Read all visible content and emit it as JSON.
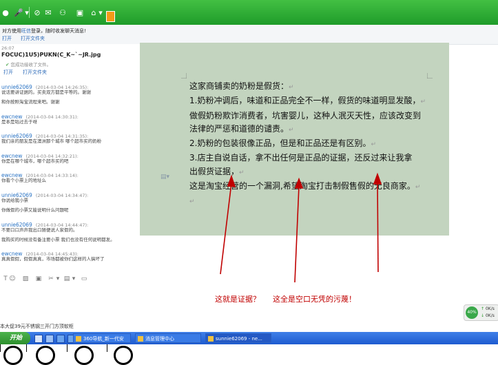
{
  "notice": {
    "text_prefix": "对方使用",
    "text_link": "旺信",
    "text_suffix": "登录，随时收发聊天消息!",
    "open": "打开",
    "open_folder": "打开文件夹"
  },
  "chat": {
    "time_fragment": "26:07",
    "file_name": "FOCUC)1U5)PUKN(C_K~`~JR.jpg",
    "file_status": "您成功接收了文件。",
    "open": "打开",
    "open_folder": "打开文件夹",
    "messages": [
      {
        "name": "unnie62069",
        "date": "(2014-03-04 14:26:35):",
        "text": "说话要讲证据的。买卖双方都是平等的。谢谢"
      },
      {
        "name": "",
        "date": "",
        "text": "和你按照淘宝流程来吧。谢谢"
      },
      {
        "name": "ewcnew",
        "date": "(2014-03-04 14:30:31):",
        "text": "是本是咕过去于呀"
      },
      {
        "name": "unnie62069",
        "date": "(2014-03-04 14:31:35):",
        "text": "我们亲的朋友是在澳洲那个城市 哪个超市买的奶粉"
      },
      {
        "name": "ewcnew",
        "date": "(2014-03-04 14:32:21):",
        "text": "你是在哪个城市，哪个超市买的吧"
      },
      {
        "name": "ewcnew",
        "date": "(2014-03-04 14:33:14):",
        "text": "你看个小票上的地址么"
      },
      {
        "name": "unnie62069",
        "date": "(2014-03-04 14:34:47):",
        "text": "你说给我小票"
      },
      {
        "name": "",
        "date": "",
        "text": "你做假的小票又能说明什么问题呢"
      },
      {
        "name": "unnie62069",
        "date": "(2014-03-04 14:44:47):",
        "text": "不要口口声声我出口随便说人家假的。"
      },
      {
        "name": "",
        "date": "",
        "text": "我购买的时候没有备注要小票 我们也没有任何说明都发。"
      },
      {
        "name": "ewcnew",
        "date": "(2014-03-04 14:45:43):",
        "text": "真真假假，假假真真，市场都被你们这样的人搞坏了"
      }
    ]
  },
  "document": {
    "lines": [
      "这家商铺卖的奶粉是假货：",
      "1.奶粉冲调后，味道和正品完全不一样，假货的味道明显发酸，",
      "做假奶粉欺诈消费者，坑害婴儿，这种人泯灭天性，应该改变到",
      "法律的严惩和道德的谴责。",
      "2.奶粉的包装很像正品，但是和正品还是有区别。",
      "3.店主自说自话，拿不出任何是正品的证据，还反过来让我拿",
      "出假货证据，",
      "这是淘宝经营的一个漏洞,希望淘宝打击制假售假的无良商家。"
    ],
    "paragraph_mark": "↵"
  },
  "annotation": {
    "left": "这就是证据？",
    "right": "这全是空口无凭的污蔑！",
    "color": "#c00000"
  },
  "ad_text": "本大促39元不锈钢三开门方顶软柜",
  "widget": {
    "percent": "40%",
    "up": "0K/s",
    "down": "0K/s"
  },
  "taskbar": {
    "start": "开始",
    "tasks": [
      "360导航_新一代安",
      "消息管理中心",
      "sunnie62069 - ne..."
    ]
  }
}
